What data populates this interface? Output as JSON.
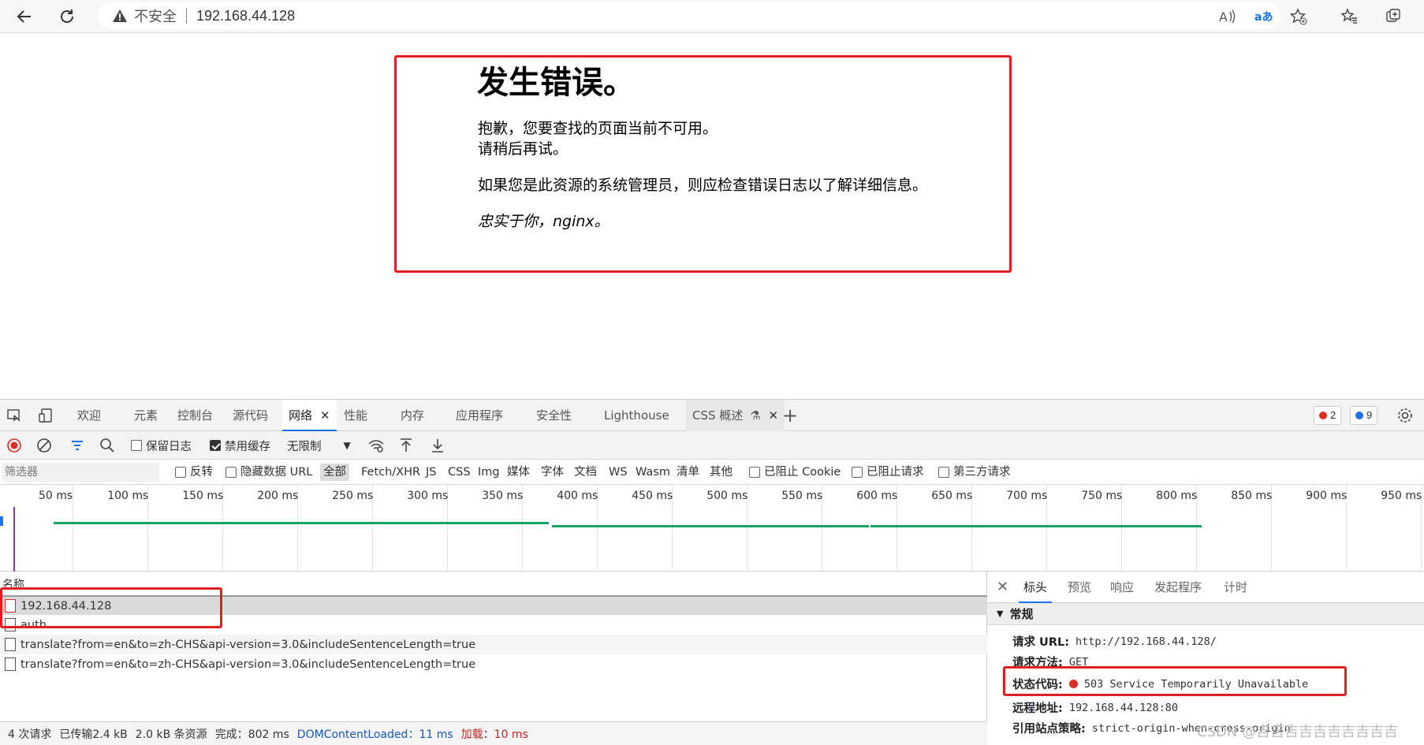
{
  "browser": {
    "security_label": "不安全",
    "url": "192.168.44.128"
  },
  "error_page": {
    "title": "发生错误。",
    "line1": "抱歉，您要查找的页面当前不可用。",
    "line2": "请稍后再试。",
    "line3": "如果您是此资源的系统管理员，则应检查错误日志以了解详细信息。",
    "signature": "忠实于你，nginx。"
  },
  "devtools": {
    "tabs": [
      "欢迎",
      "元素",
      "控制台",
      "源代码",
      "网络",
      "性能",
      "内存",
      "应用程序",
      "安全性",
      "Lighthouse",
      "CSS 概述"
    ],
    "active_tab": "网络",
    "error_count": "2",
    "message_count": "9",
    "toolbar": {
      "preserve_log": "保留日志",
      "disable_cache": "禁用缓存",
      "throttle": "无限制"
    },
    "filter": {
      "placeholder": "筛选器",
      "invert": "反转",
      "hide_data_urls": "隐藏数据 URL",
      "types": [
        "全部",
        "Fetch/XHR",
        "JS",
        "CSS",
        "Img",
        "媒体",
        "字体",
        "文档",
        "WS",
        "Wasm",
        "清单",
        "其他"
      ],
      "blocked_cookies": "已阻止 Cookie",
      "blocked_requests": "已阻止请求",
      "third_party": "第三方请求"
    },
    "timeline_ticks": [
      "50 ms",
      "100 ms",
      "150 ms",
      "200 ms",
      "250 ms",
      "300 ms",
      "350 ms",
      "400 ms",
      "450 ms",
      "500 ms",
      "550 ms",
      "600 ms",
      "650 ms",
      "700 ms",
      "750 ms",
      "800 ms",
      "850 ms",
      "900 ms",
      "950 ms"
    ],
    "requests": {
      "column_name": "名称",
      "rows": [
        "192.168.44.128",
        "auth",
        "translate?from=en&to=zh-CHS&api-version=3.0&includeSentenceLength=true",
        "translate?from=en&to=zh-CHS&api-version=3.0&includeSentenceLength=true"
      ]
    },
    "summary": {
      "requests": "4 次请求",
      "transferred": "已传输2.4 kB",
      "resources": "2.0 kB 条资源",
      "finish": "完成：802 ms",
      "dcl_label": "DOMContentLoaded：",
      "dcl_value": "11 ms",
      "load_label": "加载：",
      "load_value": "10 ms"
    },
    "detail": {
      "tabs": [
        "标头",
        "预览",
        "响应",
        "发起程序",
        "计时"
      ],
      "section": "常规",
      "request_url_label": "请求 URL:",
      "request_url": "http://192.168.44.128/",
      "method_label": "请求方法:",
      "method": "GET",
      "status_label": "状态代码:",
      "status": "503 Service Temporarily Unavailable",
      "remote_label": "远程地址:",
      "remote": "192.168.44.128:80",
      "referrer_label": "引用站点策略:",
      "referrer": "strict-origin-when-cross-origin"
    },
    "colors": {
      "accent": "#1a73e8",
      "error": "#d93025",
      "timeline_bar": "#1aa260",
      "highlight_box": "#e02020"
    }
  },
  "watermark": "CSDN @吉吉吉吉吉吉吉吉吉吉"
}
